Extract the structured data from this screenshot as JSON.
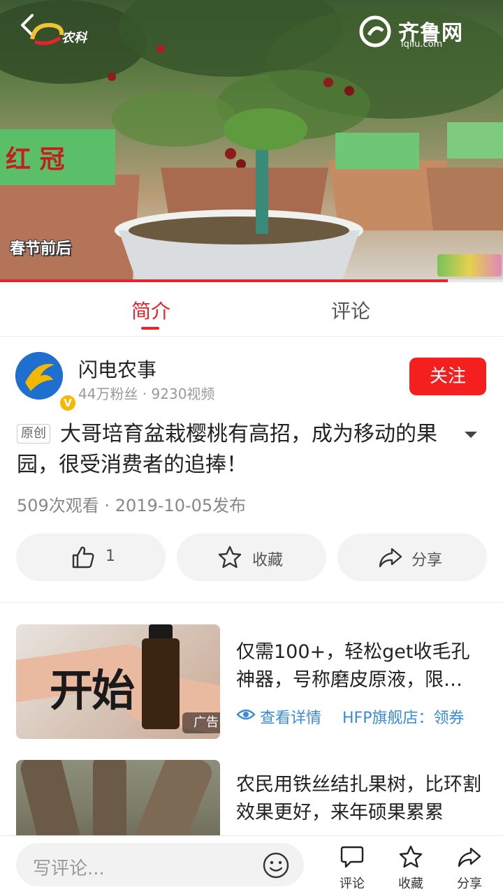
{
  "video": {
    "logo_left_text": "农科",
    "logo_right_name": "齐鲁网",
    "logo_right_url": "iqilu.com",
    "caption": "春节前后",
    "progress": 0.89,
    "colors": {
      "progress": "#e8232b"
    }
  },
  "tabs": [
    {
      "label": "简介",
      "active": true
    },
    {
      "label": "评论",
      "active": false
    }
  ],
  "author": {
    "name": "闪电农事",
    "meta": "44万粉丝 · 9230视频",
    "verified_badge": "V",
    "follow_label": "关注"
  },
  "post": {
    "badge": "原创",
    "title": "大哥培育盆栽樱桃有高招，成为移动的果园，很受消费者的追捧！",
    "views": "509次观看 · 2019-10-05发布"
  },
  "actions": {
    "like_count": "1",
    "favorite_label": "收藏",
    "share_label": "分享"
  },
  "feed": [
    {
      "title": "仅需100+，轻松get收毛孔神器，号称磨皮原液，限…",
      "thumb_text": "开始",
      "ad_tag": "广告",
      "link_label": "查看详情",
      "store_label": "HFP旗舰店：领券"
    },
    {
      "title": "农民用铁丝结扎果树，比环割效果更好，来年硕果累累"
    }
  ],
  "bottom": {
    "comment_placeholder": "写评论...",
    "comment_label": "评论",
    "favorite_label": "收藏",
    "share_label": "分享"
  },
  "colors": {
    "accent": "#e8232b",
    "follow": "#f41f1f",
    "link": "#3a8ad8"
  }
}
